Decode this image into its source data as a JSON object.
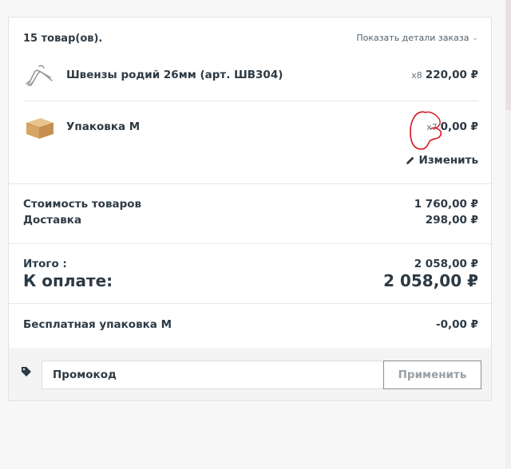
{
  "cart": {
    "count_label": "15 товар(ов).",
    "details_link": "Показать детали заказа",
    "items": [
      {
        "name": "Швензы родий 26мм (арт. ШВ304)",
        "qty": "x8",
        "price": "220,00 ₽",
        "thumb_icon": "earring-hooks-icon"
      },
      {
        "name": "Упаковка М",
        "qty": "x7",
        "price": "0,00 ₽",
        "thumb_icon": "box-icon",
        "edit_label": "Изменить"
      }
    ]
  },
  "summary": {
    "goods_label": "Стоимость товаров",
    "goods_value": "1 760,00 ₽",
    "delivery_label": "Доставка",
    "delivery_value": "298,00 ₽",
    "total_label": "Итого :",
    "total_value": "2 058,00 ₽",
    "pay_label": "К оплате:",
    "pay_value": "2 058,00 ₽"
  },
  "discount": {
    "label": "Бесплатная упаковка М",
    "value": "-0,00 ₽"
  },
  "promo": {
    "placeholder": "Промокод",
    "value": "",
    "apply_label": "Применить",
    "icon": "tag-icon"
  },
  "colors": {
    "text": "#2d3a44",
    "annotation": "#d8141e",
    "button_border": "#8e8e8e"
  }
}
